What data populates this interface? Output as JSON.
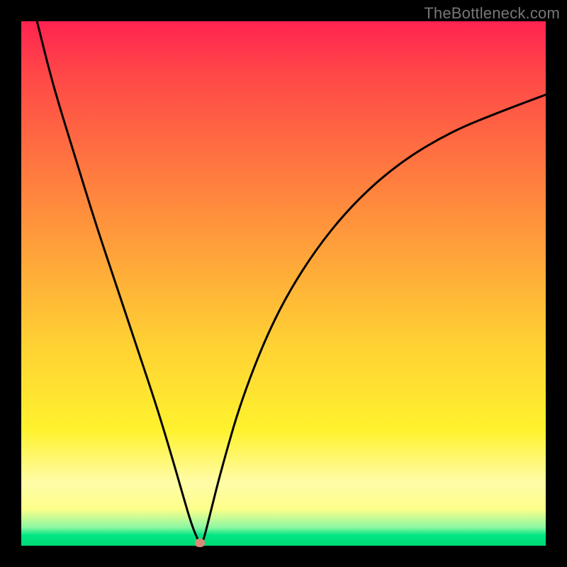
{
  "watermark": "TheBottleneck.com",
  "chart_data": {
    "type": "line",
    "title": "",
    "xlabel": "",
    "ylabel": "",
    "xlim": [
      0,
      100
    ],
    "ylim": [
      0,
      100
    ],
    "grid": false,
    "series": [
      {
        "name": "bottleneck-curve",
        "x": [
          3,
          6,
          10,
          14,
          18,
          22,
          26,
          29,
          31,
          32.5,
          33.5,
          34,
          34.5,
          35,
          36,
          38,
          42,
          48,
          55,
          63,
          72,
          82,
          92,
          100
        ],
        "values": [
          100,
          88,
          75,
          62,
          50,
          38,
          26,
          16,
          9,
          4,
          1.5,
          0.5,
          0.5,
          2,
          6,
          14,
          28,
          43,
          55,
          65,
          73,
          79,
          83,
          86
        ]
      }
    ],
    "annotations": [
      {
        "name": "min-marker",
        "x": 34,
        "y": 0.5
      }
    ],
    "colors": {
      "curve": "#000000",
      "marker": "#d98b7a",
      "gradient_top": "#ff2350",
      "gradient_mid": "#ffd233",
      "gradient_bottom": "#00d874"
    }
  }
}
